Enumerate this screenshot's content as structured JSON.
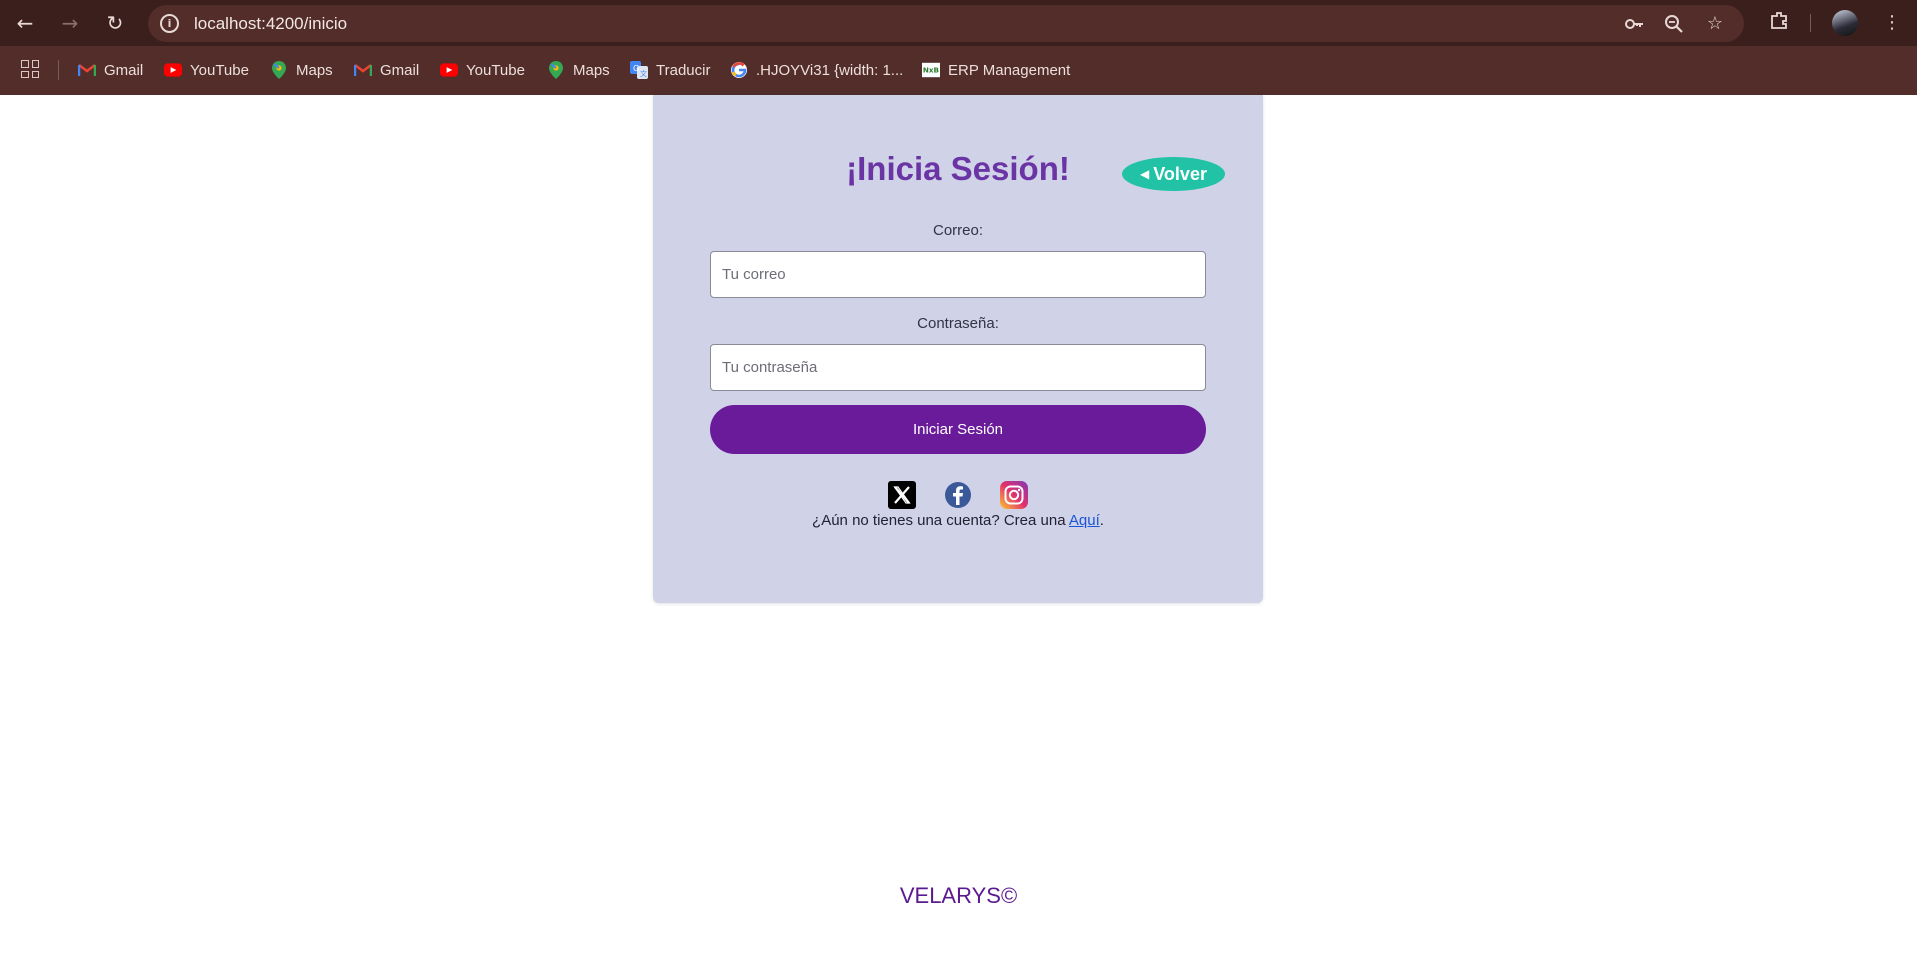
{
  "browser": {
    "url": "localhost:4200/inicio",
    "nav": {
      "back": "←",
      "forward": "→",
      "reload": "↻"
    },
    "omnibox_icons": [
      "key-icon",
      "zoom-icon",
      "star-icon"
    ],
    "bookmarks": [
      {
        "label": "Gmail",
        "icon": "gmail-icon"
      },
      {
        "label": "YouTube",
        "icon": "youtube-icon"
      },
      {
        "label": "Maps",
        "icon": "maps-icon"
      },
      {
        "label": "Gmail",
        "icon": "gmail-icon"
      },
      {
        "label": "YouTube",
        "icon": "youtube-icon"
      },
      {
        "label": "Maps",
        "icon": "maps-icon"
      },
      {
        "label": "Traducir",
        "icon": "translate-icon"
      },
      {
        "label": ".HJOYVi31 {width: 1...",
        "icon": "google-icon"
      },
      {
        "label": "ERP Management",
        "icon": "erp-icon"
      }
    ]
  },
  "login": {
    "title": "¡Inicia Sesión!",
    "back_label": "Volver",
    "email_label": "Correo:",
    "email_placeholder": "Tu correo",
    "email_value": "",
    "password_label": "Contraseña:",
    "password_placeholder": "Tu contraseña",
    "password_value": "",
    "submit_label": "Iniciar Sesión",
    "socials": [
      "x-icon",
      "facebook-icon",
      "instagram-icon"
    ],
    "signup_text": "¿Aún no tienes una cuenta? Crea una",
    "signup_link": "Aquí",
    "signup_end": "."
  },
  "footer": {
    "brand": "VELARYS©"
  },
  "colors": {
    "chrome_dark": "#3b1f1c",
    "chrome_bar": "#522d29",
    "card_bg": "#d0d2e8",
    "title_purple": "#6b34a4",
    "back_teal": "#21c2a6",
    "submit_purple": "#6a1b9a",
    "footer_purple": "#5b1a8f"
  }
}
